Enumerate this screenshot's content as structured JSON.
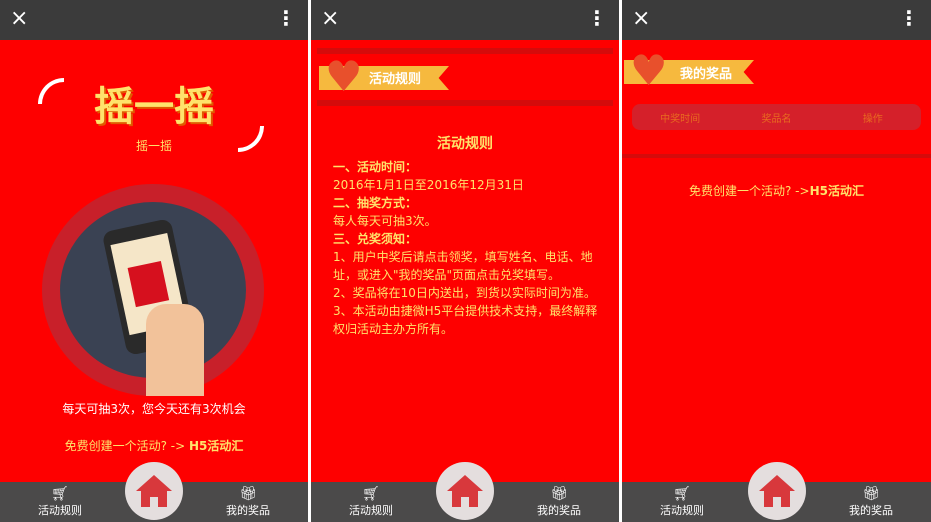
{
  "common": {
    "close_icon": "×",
    "more_icon": "⋮",
    "nav_left": "活动规则",
    "nav_right": "我的奖品"
  },
  "shake": {
    "title": "摇一摇",
    "subtitle": "摇一摇",
    "chances": "每天可抽3次，您今天还有3次机会",
    "promo_text": "免费创建一个活动? -> ",
    "promo_link": "H5活动汇"
  },
  "rules": {
    "banner": "活动规则",
    "heading": "活动规则",
    "items": [
      "一、活动时间：",
      "2016年1月1日至2016年12月31日",
      "二、抽奖方式：",
      "每人每天可抽3次。",
      "三、兑奖须知：",
      "1、用户中奖后请点击领奖，填写姓名、电话、地址，或进入\"我的奖品\"页面点击兑奖填写。",
      "2、奖品将在10日内送出，到货以实际时间为准。",
      "3、本活动由捷微H5平台提供技术支持，最终解释权归活动主办方所有。"
    ]
  },
  "prizes": {
    "banner": "我的奖品",
    "columns": [
      "中奖时间",
      "奖品名",
      "操作"
    ],
    "promo_text": "免费创建一个活动? ->",
    "promo_link": "H5活动汇"
  },
  "colors": {
    "bg": "#fe0000",
    "accent": "#ffe36b",
    "bar": "#3b3b3b"
  }
}
